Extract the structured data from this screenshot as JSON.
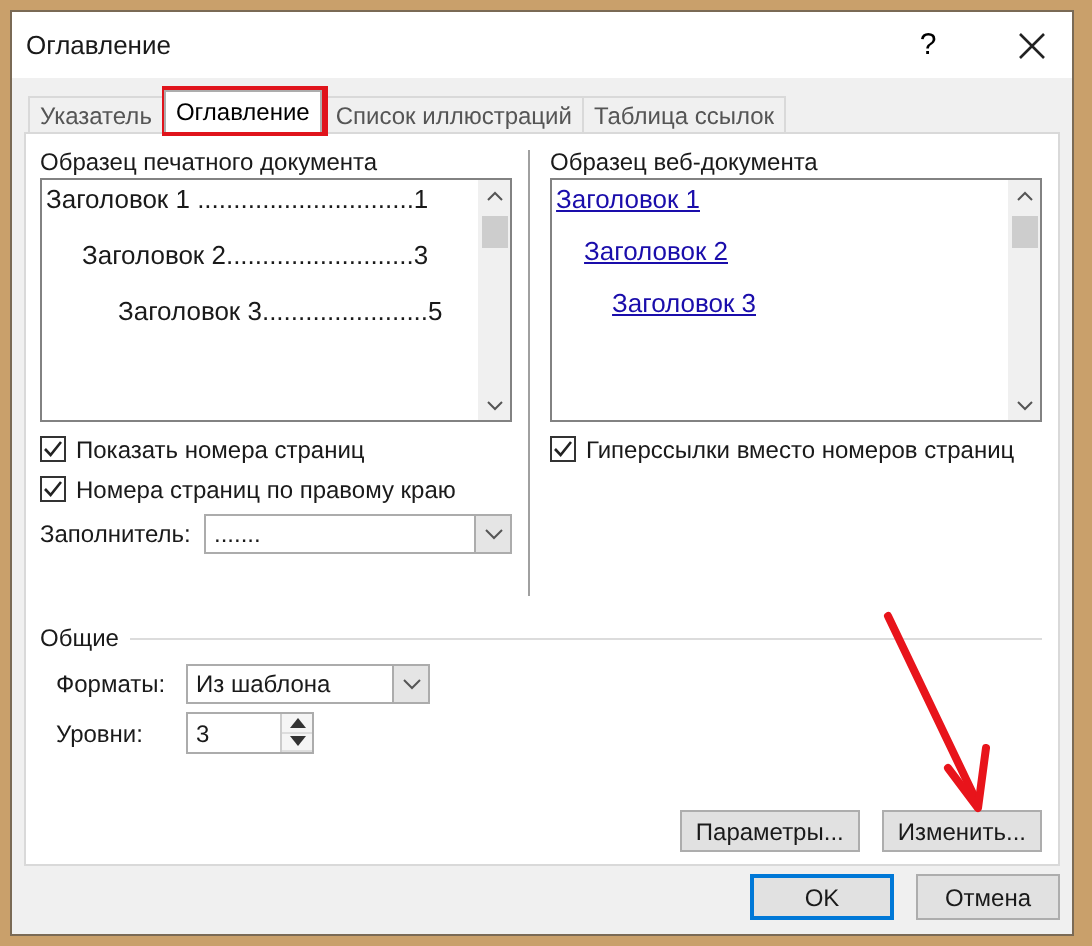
{
  "window": {
    "title": "Оглавление",
    "help": "?"
  },
  "tabs": [
    {
      "label": "Указатель",
      "selected": false
    },
    {
      "label": "Оглавление",
      "selected": true
    },
    {
      "label": "Список иллюстраций",
      "selected": false
    },
    {
      "label": "Таблица ссылок",
      "selected": false
    }
  ],
  "print_preview": {
    "label": "Образец печатного документа",
    "entries": [
      {
        "text": "Заголовок 1",
        "leader": " ..............................",
        "page": "1"
      },
      {
        "text": "Заголовок 2",
        "leader": "..........................",
        "page": "3"
      },
      {
        "text": "Заголовок 3",
        "leader": ".......................",
        "page": "5"
      }
    ]
  },
  "print_options": [
    {
      "label": "Показать номера страниц",
      "checked": true
    },
    {
      "label": "Номера страниц по правому краю",
      "checked": true
    }
  ],
  "leader_field": {
    "label": "Заполнитель:",
    "value": "......."
  },
  "web_preview": {
    "label": "Образец веб-документа",
    "entries": [
      {
        "text": "Заголовок 1"
      },
      {
        "text": "Заголовок 2"
      },
      {
        "text": "Заголовок 3"
      }
    ]
  },
  "web_options": [
    {
      "label": "Гиперссылки вместо номеров страниц",
      "checked": true
    }
  ],
  "general": {
    "title": "Общие",
    "formats": {
      "label": "Форматы:",
      "value": "Из шаблона"
    },
    "levels": {
      "label": "Уровни:",
      "value": "3"
    }
  },
  "panel_buttons": [
    "Параметры...",
    "Изменить..."
  ],
  "dialog_buttons": [
    {
      "label": "OK",
      "default": true
    },
    {
      "label": "Отмена",
      "default": false
    }
  ]
}
